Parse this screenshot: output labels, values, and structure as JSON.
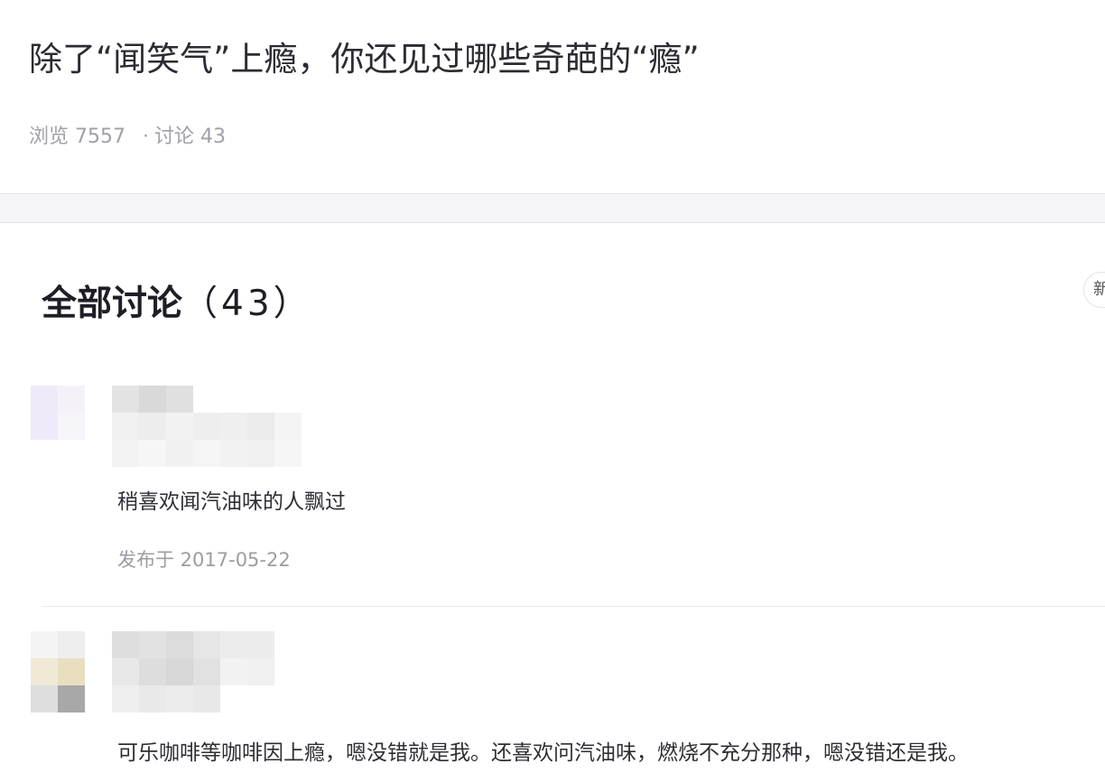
{
  "question": {
    "title": "除了“闻笑气”上瘾，你还见过哪些奇葩的“瘾”",
    "views_label": "浏览",
    "views_count": "7557",
    "separator": "·",
    "discuss_label": "讨论",
    "discuss_count": "43"
  },
  "discussion": {
    "heading": "全部讨论",
    "count_display": "（43）",
    "sort_tab_label": "新"
  },
  "comments": [
    {
      "text": "稍喜欢闻汽油味的人飘过",
      "date": "发布于 2017-05-22"
    },
    {
      "text": "可乐咖啡等咖啡因上瘾，嗯没错就是我。还喜欢问汽油味，燃烧不充分那种，嗯没错还是我。"
    }
  ],
  "colors": {
    "title_text": "#2b2b33",
    "muted_text": "#a0a0a8",
    "background": "#f5f5f7",
    "card": "#ffffff"
  }
}
